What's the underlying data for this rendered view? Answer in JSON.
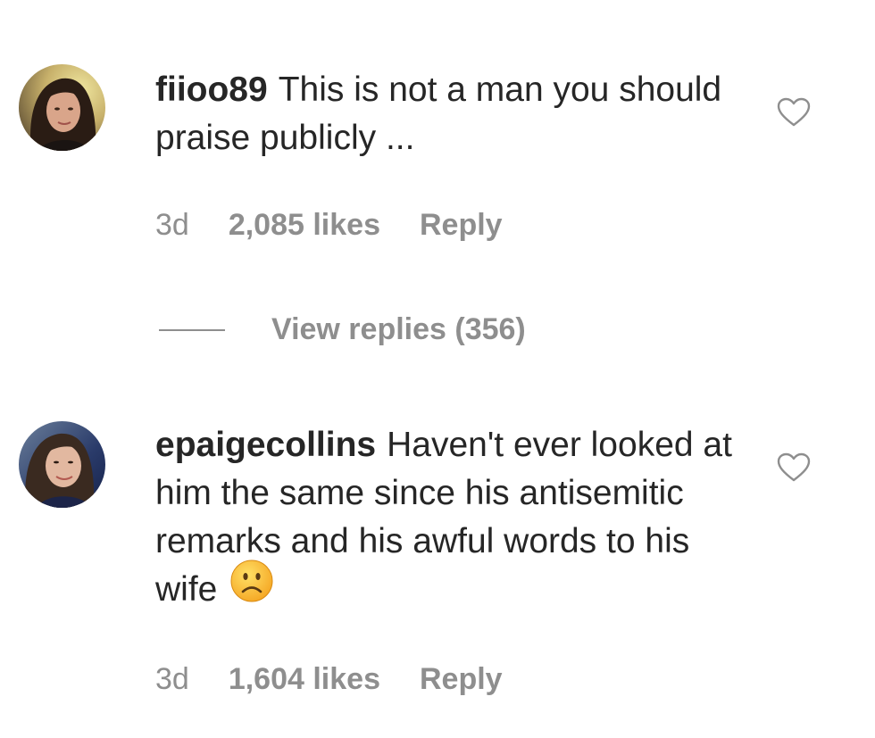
{
  "comments": [
    {
      "username": "fiioo89",
      "text": "This is not a man you should praise publicly ...",
      "time": "3d",
      "likes": "2,085 likes",
      "reply_label": "Reply",
      "avatar_icon": "avatar-photo-woman-dark-hair",
      "heart_icon": "heart-outline-icon"
    },
    {
      "username": "epaigecollins",
      "text": "Haven't ever looked at him the same since his antisemitic remarks and his awful words to his wife",
      "emoji": "frowning-face-emoji",
      "time": "3d",
      "likes": "1,604 likes",
      "reply_label": "Reply",
      "avatar_icon": "avatar-photo-woman-smiling",
      "heart_icon": "heart-outline-icon"
    }
  ],
  "view_replies": {
    "label": "View replies (356)"
  },
  "colors": {
    "text": "#262626",
    "secondary": "#8e8e8e",
    "background": "#ffffff"
  }
}
